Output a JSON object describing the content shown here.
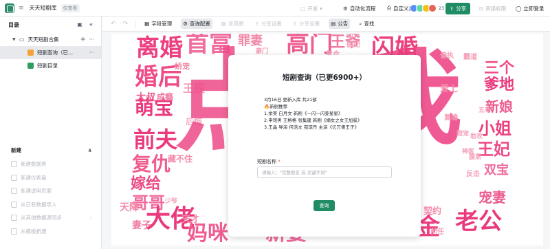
{
  "app": {
    "title": "天天短剧库",
    "readonly_badge": "仅查看"
  },
  "topbar": {
    "dev_label": "开发",
    "automation_label": "自动化流程",
    "custom_print_label": "自定义打印",
    "avatar_count": "23",
    "share_label": "分享",
    "advanced_permission_label": "高级权限",
    "login_label": "立即登录"
  },
  "sidebar": {
    "header": "目录",
    "tree": {
      "root_label": "天天短剧合集",
      "items": [
        {
          "label": "短剧查询（已...",
          "selected": true,
          "icon_color": "#f2a33a"
        },
        {
          "label": "短剧目录",
          "selected": false,
          "icon_color": "#2f9e5e"
        }
      ]
    },
    "new_section": {
      "title": "新建",
      "items": [
        {
          "label": "新建数据表"
        },
        {
          "label": "新建仪表盘"
        },
        {
          "label": "新建说明页面"
        },
        {
          "label": "从已有数据导入"
        },
        {
          "label": "从其他数据源同步"
        },
        {
          "label": "从模板新建"
        }
      ]
    }
  },
  "toolbar": {
    "buttons": [
      {
        "label": "字段管理",
        "icon": "gear-fields-icon",
        "active": false,
        "disabled": false
      },
      {
        "label": "查询配置",
        "icon": "gear-icon",
        "active": true,
        "disabled": false
      },
      {
        "label": "背景图",
        "icon": "image-icon",
        "active": false,
        "disabled": true
      },
      {
        "label": "分享设置",
        "icon": "share-icon",
        "active": false,
        "disabled": true
      },
      {
        "label": "分享设置",
        "icon": "share-settings-icon",
        "active": false,
        "disabled": true
      },
      {
        "label": "公告",
        "icon": "announcement-icon",
        "active": true,
        "disabled": false
      },
      {
        "label": "查找",
        "icon": "search-icon",
        "active": false,
        "disabled": false
      }
    ]
  },
  "modal": {
    "title": "短剧查询（已更6900+）",
    "notice_lines": [
      "3月16日 更新入库 共21部",
      "🔥新剧推荐",
      "1.余美 白月文 新剧《一闪一闪姜星星》",
      "2.申馆男 王格格 张集建 新剧《嫡女之女王加冕》",
      "3.王晶 导演 何浩文 苑琼丹 主演《亿万傻王子》"
    ],
    "field_label": "短剧名称",
    "field_required_mark": "*",
    "field_placeholder": "请输入：\"完整剧名 或 关键字词\"",
    "search_button": "查询"
  },
  "wordcloud": [
    {
      "text": "离婚",
      "color": "#ee3e82"
    },
    {
      "text": "首富",
      "color": "#f06b9e"
    },
    {
      "text": "罪妻",
      "color": "#f28aa8"
    },
    {
      "text": "高门",
      "color": "#ee5c90"
    },
    {
      "text": "王爷",
      "color": "#f07aa0"
    },
    {
      "text": "闪婚",
      "color": "#ec3f7e"
    },
    {
      "text": "婚后",
      "color": "#ee4b88"
    },
    {
      "text": "娇宠",
      "color": "#f28aa8"
    },
    {
      "text": "王辰",
      "color": "#f4a0b8"
    },
    {
      "text": "萌宝",
      "color": "#ea3a7e"
    },
    {
      "text": "大叔",
      "color": "#ee5c90"
    },
    {
      "text": "成瘾",
      "color": "#f07aa0"
    },
    {
      "text": "后悔",
      "color": "#f4b0c4"
    },
    {
      "text": "前夫",
      "color": "#ea3a7e"
    },
    {
      "text": "藏不住",
      "color": "#f28aa8"
    },
    {
      "text": "复仇",
      "color": "#ee5c90"
    },
    {
      "text": "嫁给",
      "color": "#ec4a86"
    },
    {
      "text": "哥哥",
      "color": "#f06b9e"
    },
    {
      "text": "天降",
      "color": "#f28aa8"
    },
    {
      "text": "大佬",
      "color": "#ea3a7e"
    },
    {
      "text": "妻子",
      "color": "#f07aa0"
    },
    {
      "text": "天才",
      "color": "#f28aa8"
    },
    {
      "text": "少爷",
      "color": "#f4a0b8"
    },
    {
      "text": "妈咪",
      "color": "#ee5c90"
    },
    {
      "text": "新婆",
      "color": "#f06b9e"
    },
    {
      "text": "三个",
      "color": "#ee4b88"
    },
    {
      "text": "爹地",
      "color": "#ea3a7e"
    },
    {
      "text": "新娘",
      "color": "#ee5c90"
    },
    {
      "text": "小姐",
      "color": "#ec3f7e"
    },
    {
      "text": "王妃",
      "color": "#ee4b88"
    },
    {
      "text": "双宝",
      "color": "#f06b9e"
    },
    {
      "text": "宠妻",
      "color": "#ee5c90"
    },
    {
      "text": "老公",
      "color": "#ea3a7e"
    },
    {
      "text": "金",
      "color": "#ee3e82"
    },
    {
      "text": "点",
      "color": "#ee4b88"
    },
    {
      "text": "我",
      "color": "#ee3e82"
    },
    {
      "text": "白月光",
      "color": "#f07aa0"
    },
    {
      "text": "契约",
      "color": "#f28aa8"
    },
    {
      "text": "霸道",
      "color": "#f4a0b8"
    },
    {
      "text": "偏执",
      "color": "#f4a0b8"
    },
    {
      "text": "爱上",
      "color": "#f28aa8"
    },
    {
      "text": "五年",
      "color": "#f4a0b8"
    },
    {
      "text": "复婚",
      "color": "#f4a0b8"
    },
    {
      "text": "反击",
      "color": "#f4a0b8"
    },
    {
      "text": "秘书",
      "color": "#f28aa8"
    },
    {
      "text": "前任",
      "color": "#f4a0b8"
    },
    {
      "text": "团宠",
      "color": "#f4a0b8"
    },
    {
      "text": "复合",
      "color": "#f4a0b8"
    },
    {
      "text": "医妃",
      "color": "#f4a0b8"
    },
    {
      "text": "助攻",
      "color": "#f4a0b8"
    },
    {
      "text": "甜宠",
      "color": "#f4a0b8"
    },
    {
      "text": "腹黑",
      "color": "#f4a0b8"
    },
    {
      "text": "神医",
      "color": "#f4a0b8"
    },
    {
      "text": "豪门",
      "color": "#f4a0b8"
    }
  ]
}
